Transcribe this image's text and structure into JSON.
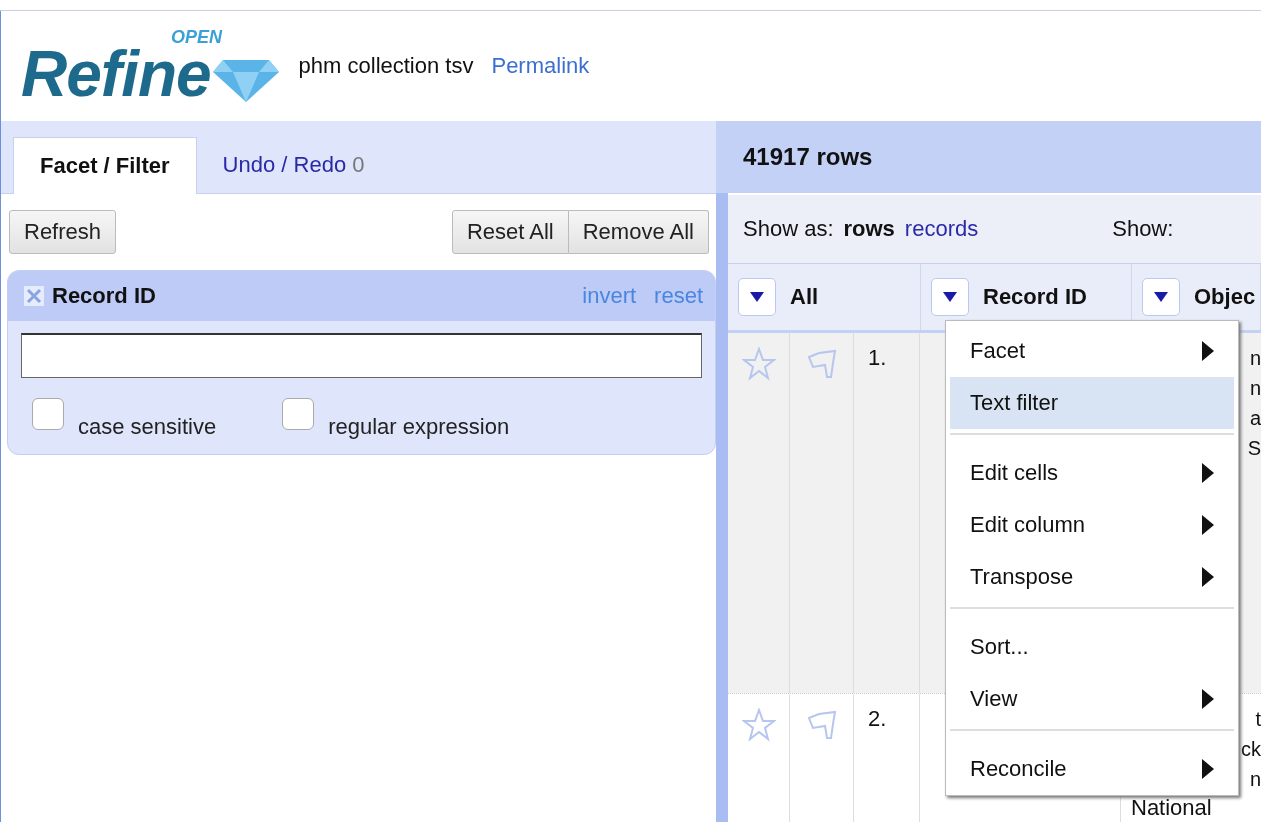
{
  "header": {
    "logo_word": "Refine",
    "logo_super": "OPEN",
    "project": "phm collection tsv",
    "permalink": "Permalink"
  },
  "left_tabs": [
    {
      "label": "Facet / Filter",
      "selected": true
    },
    {
      "label": "Undo / Redo",
      "count": "0",
      "selected": false
    }
  ],
  "toolbar": {
    "refresh": "Refresh",
    "group": [
      "Reset All",
      "Remove All"
    ]
  },
  "facet": {
    "title": "Record ID",
    "links": [
      "invert",
      "reset"
    ],
    "options": [
      {
        "label": "case sensitive",
        "checked": false
      },
      {
        "label": "regular expression",
        "checked": false
      }
    ]
  },
  "grid": {
    "row_count": "41917 rows",
    "show_as_label": "Show as:",
    "modes": [
      {
        "label": "rows",
        "selected": true
      },
      {
        "label": "records",
        "selected": false
      }
    ],
    "show_label": "Show:",
    "columns": [
      "All",
      "Record ID",
      "Objec"
    ],
    "rows": [
      {
        "index": "1.",
        "object_fragments": [
          "n",
          "n",
          "a",
          "S"
        ]
      },
      {
        "index": "2.",
        "object_fragments": [
          "t",
          "ck",
          "n"
        ],
        "object_line": "National"
      }
    ]
  },
  "menu": {
    "items": [
      {
        "kind": "item",
        "label": "Facet",
        "submenu": true,
        "selected": false
      },
      {
        "kind": "item",
        "label": "Text filter",
        "submenu": false,
        "selected": true
      },
      {
        "kind": "separator"
      },
      {
        "kind": "item",
        "label": "Edit cells",
        "submenu": true,
        "selected": false
      },
      {
        "kind": "item",
        "label": "Edit column",
        "submenu": true,
        "selected": false
      },
      {
        "kind": "item",
        "label": "Transpose",
        "submenu": true,
        "selected": false
      },
      {
        "kind": "separator"
      },
      {
        "kind": "item",
        "label": "Sort...",
        "submenu": false,
        "selected": false
      },
      {
        "kind": "item",
        "label": "View",
        "submenu": true,
        "selected": false
      },
      {
        "kind": "separator"
      },
      {
        "kind": "item",
        "label": "Reconcile",
        "submenu": true,
        "selected": false
      }
    ]
  }
}
